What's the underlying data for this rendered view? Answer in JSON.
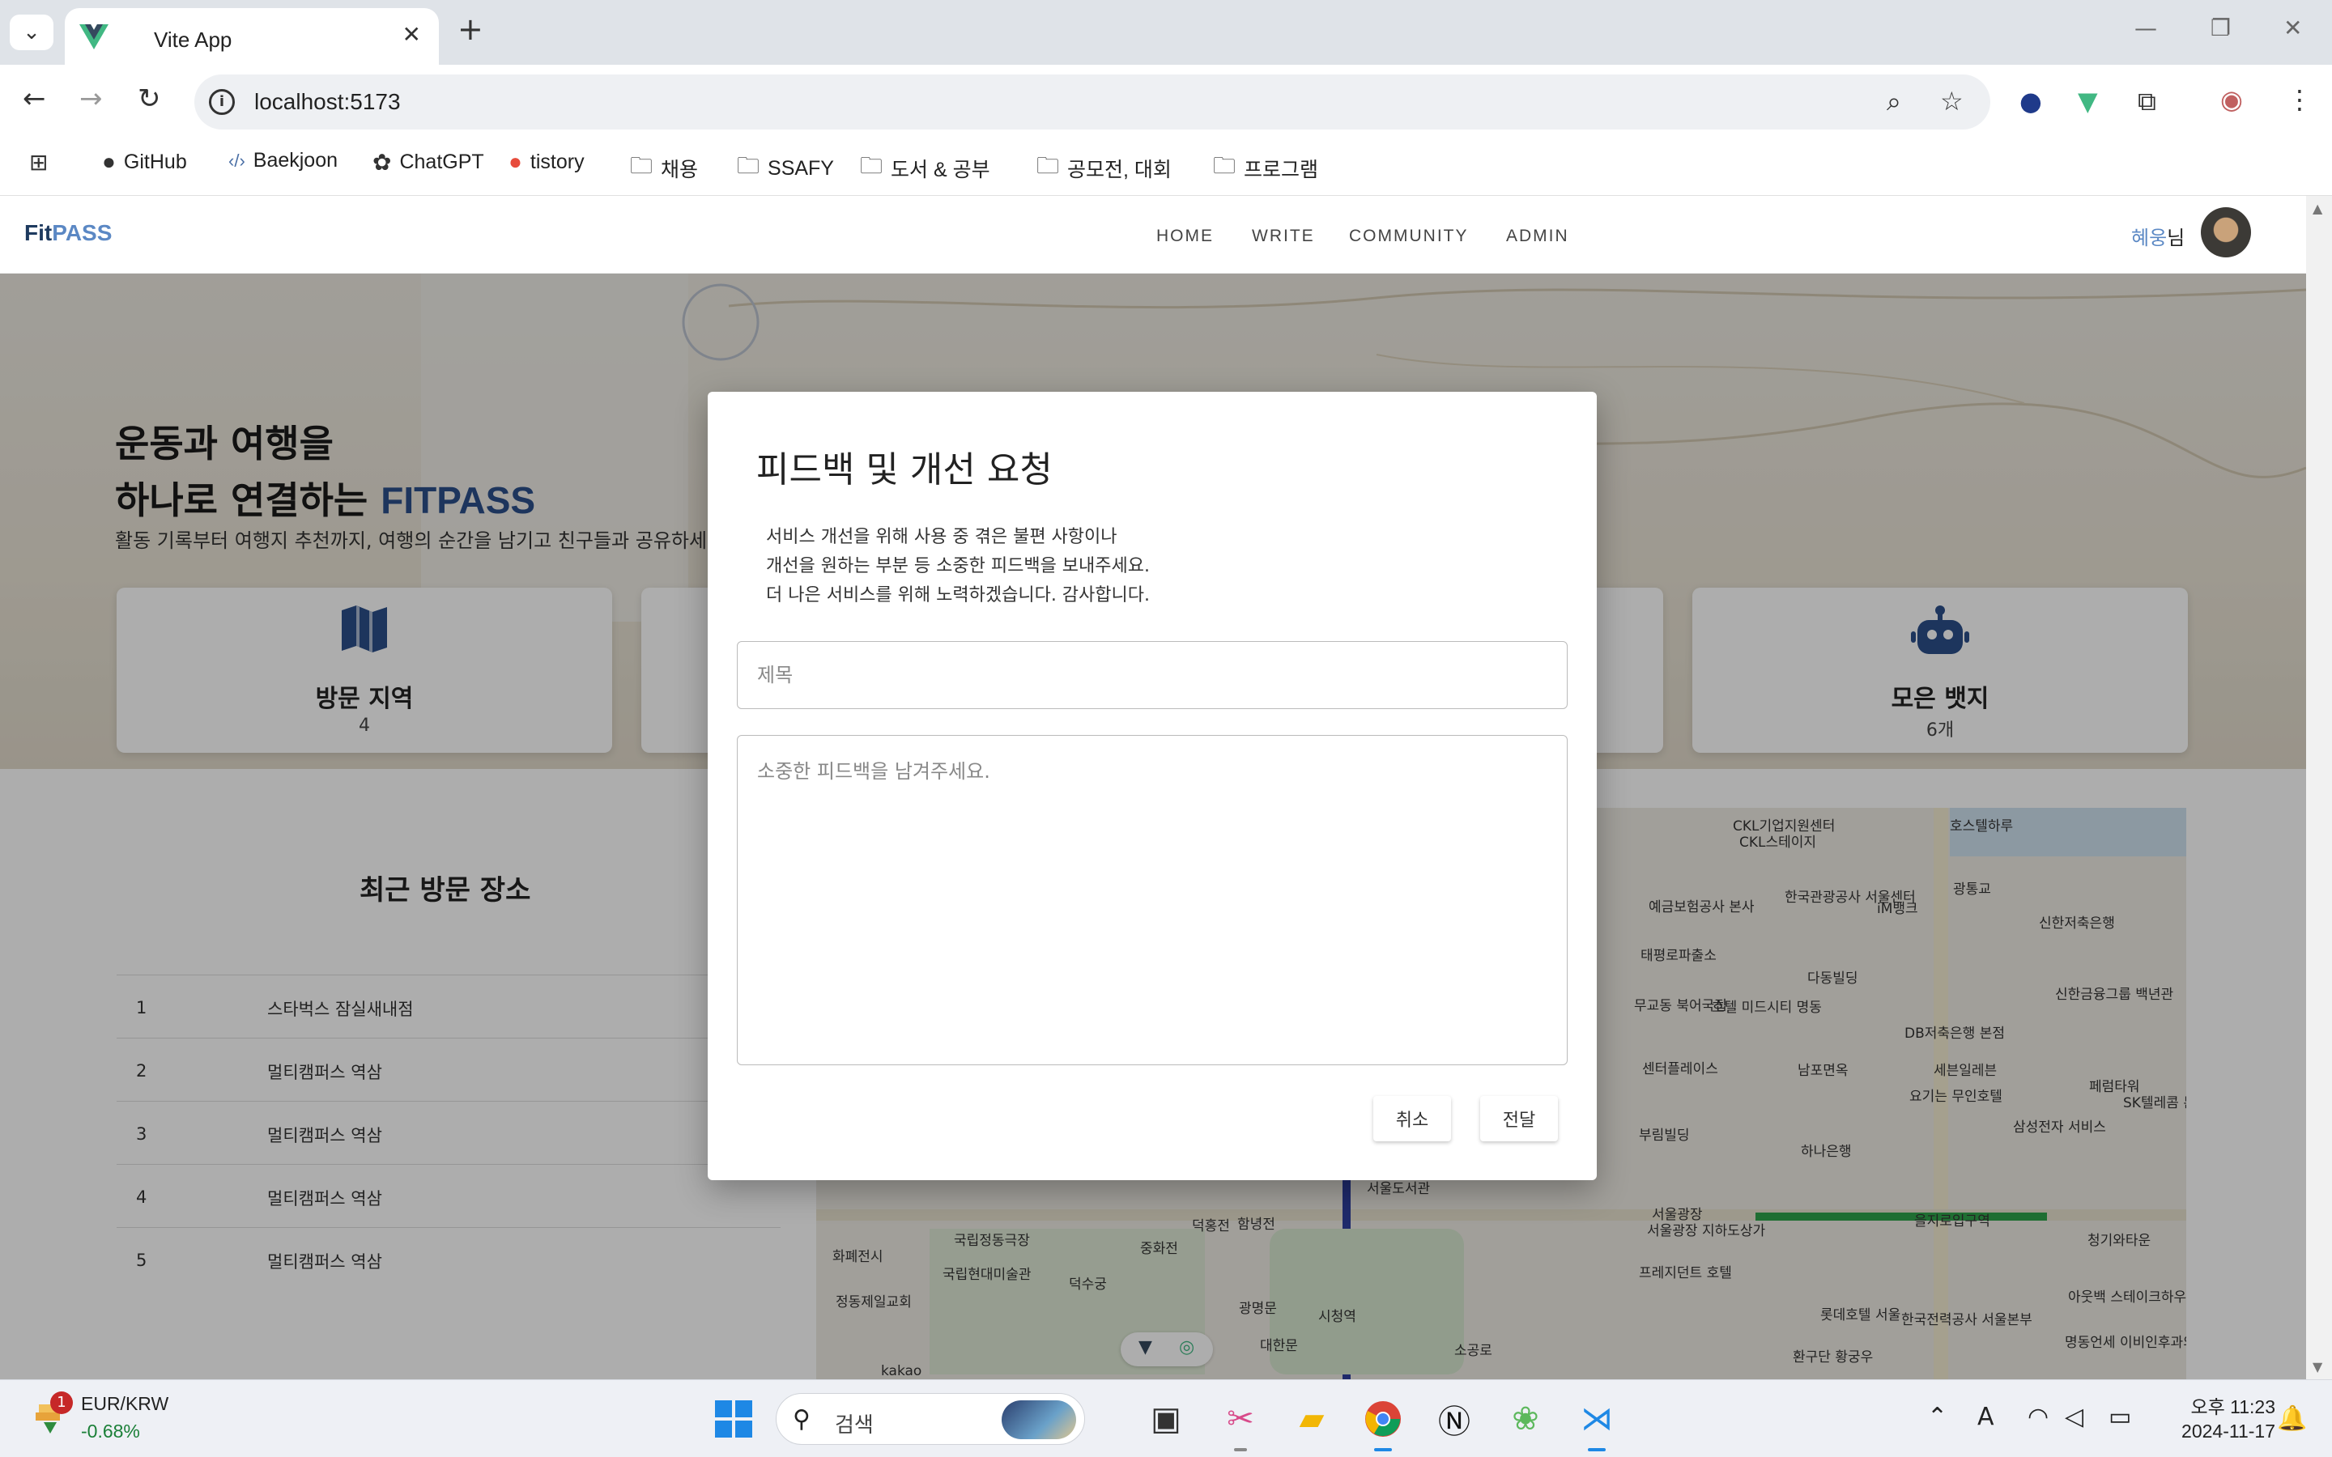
{
  "browser": {
    "tab_title": "Vite App",
    "url": "localhost:5173",
    "bookmarks": [
      {
        "label": "GitHub",
        "icon": "github-icon"
      },
      {
        "label": "Baekjoon",
        "icon": "code-icon"
      },
      {
        "label": "ChatGPT",
        "icon": "chatgpt-icon"
      },
      {
        "label": "tistory",
        "icon": "tistory-icon"
      },
      {
        "label": "채용",
        "icon": "folder-icon"
      },
      {
        "label": "SSAFY",
        "icon": "folder-icon"
      },
      {
        "label": "도서 & 공부",
        "icon": "folder-icon"
      },
      {
        "label": "공모전, 대회",
        "icon": "folder-icon"
      },
      {
        "label": "프로그램",
        "icon": "folder-icon"
      }
    ]
  },
  "site": {
    "logo": {
      "part1": "Fit",
      "part2": "PASS"
    },
    "menu": [
      "HOME",
      "WRITE",
      "COMMUNITY",
      "ADMIN"
    ],
    "user": {
      "name": "혜웅",
      "suffix": "님"
    }
  },
  "hero": {
    "line1": "운동과 여행을",
    "line2": "하나로 연결하는 ",
    "brand": "FITPASS",
    "subtitle": "활동 기록부터 여행지 추천까지, 여행의 순간을 남기고 친구들과 공유하세요"
  },
  "stats": [
    {
      "label": "방문 지역",
      "value": "4",
      "icon": "map-icon"
    },
    {
      "label": "모은 뱃지",
      "value": "6개",
      "icon": "robot-icon"
    }
  ],
  "recent": {
    "title": "최근 방문 장소",
    "items": [
      {
        "idx": "1",
        "place": "스타벅스 잠실새내점"
      },
      {
        "idx": "2",
        "place": "멀티캠퍼스 역삼"
      },
      {
        "idx": "3",
        "place": "멀티캠퍼스 역삼"
      },
      {
        "idx": "4",
        "place": "멀티캠퍼스 역삼"
      },
      {
        "idx": "5",
        "place": "멀티캠퍼스 역삼"
      }
    ]
  },
  "map": {
    "labels": [
      "CKL기업지원센터",
      "CKL스테이지",
      "호스텔하루",
      "예금보험공사 본사",
      "한국관광공사 서울센터",
      "iM뱅크",
      "광통교",
      "신한저축은행",
      "태평로파출소",
      "다동빌딩",
      "신한금융그룹 백년관",
      "무교동 북어국집",
      "호텔 미드시티 명동",
      "DB저축은행 본점",
      "센터플레이스",
      "남포면옥",
      "세븐일레븐",
      "페럼타워",
      "SK텔레콤 본사",
      "부림빌딩",
      "요기는 무인호텔",
      "하나은행",
      "삼성전자 서비스",
      "서울도서관",
      "서울광장",
      "청기와타운",
      "화폐전시",
      "국립정동극장",
      "국립현대미술관",
      "덕수궁",
      "덕홍전",
      "함녕전",
      "중화전",
      "광명문",
      "대한문",
      "시청역",
      "프레지던트 호텔",
      "롯데호텔 서울",
      "한국전력공사 서울본부",
      "아웃백 스테이크하우스",
      "명동언세 이비인후과의원",
      "정동제일교회",
      "환구단 황궁우",
      "소공로",
      "을지로입구역",
      "서울광장 지하도상가",
      "kakao"
    ]
  },
  "modal": {
    "title": "피드백 및 개선 요청",
    "desc": [
      "서비스 개선을 위해 사용 중 겪은 불편 사항이나",
      "개선을 원하는 부분 등 소중한 피드백을 보내주세요.",
      "더 나은 서비스를 위해 노력하겠습니다. 감사합니다."
    ],
    "title_placeholder": "제목",
    "body_placeholder": "소중한 피드백을 남겨주세요.",
    "cancel_label": "취소",
    "submit_label": "전달"
  },
  "taskbar": {
    "stock_name": "EUR/KRW",
    "stock_change": "-0.68%",
    "stock_badge": "1",
    "search_label": "검색",
    "time": "오후 11:23",
    "date": "2024-11-17"
  },
  "colors": {
    "brand": "#2c4f8a",
    "accent": "#5b88c4",
    "positive": "#1a7f37"
  }
}
